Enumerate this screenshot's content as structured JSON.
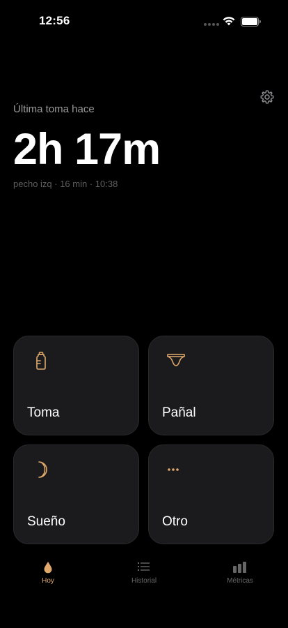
{
  "status_bar": {
    "time": "12:56"
  },
  "header": {
    "last_label": "Última toma hace",
    "elapsed": "2h 17m",
    "details": "pecho izq · 16 min · 10:38"
  },
  "actions": [
    {
      "label": "Toma",
      "icon": "bottle-icon"
    },
    {
      "label": "Pañal",
      "icon": "diaper-icon"
    },
    {
      "label": "Sueño",
      "icon": "moon-icon"
    },
    {
      "label": "Otro",
      "icon": "more-dots-icon"
    }
  ],
  "tabs": [
    {
      "label": "Hoy",
      "icon": "drop-icon",
      "active": true
    },
    {
      "label": "Historial",
      "icon": "list-icon",
      "active": false
    },
    {
      "label": "Métricas",
      "icon": "bar-chart-icon",
      "active": false
    }
  ],
  "colors": {
    "accent": "#e0a96b",
    "background": "#000000",
    "card": "#1b1b1d",
    "inactive_tab": "#666666"
  }
}
